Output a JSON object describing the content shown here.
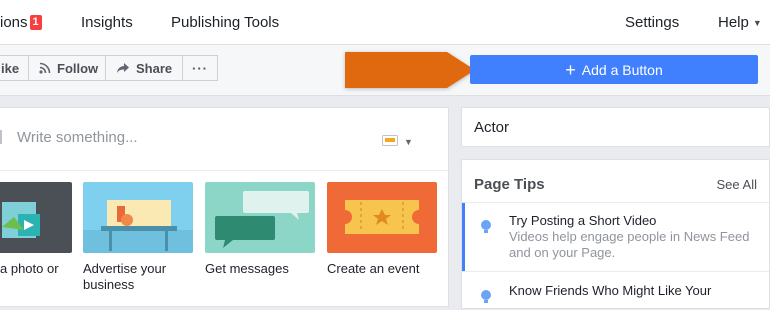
{
  "topnav": {
    "notifications_label": "ions",
    "notifications_count": "1",
    "insights": "Insights",
    "publishing_tools": "Publishing Tools",
    "settings": "Settings",
    "help": "Help"
  },
  "actions": {
    "like": "ike",
    "follow": "Follow",
    "share": "Share",
    "more": "···",
    "add_button": "Add a Button"
  },
  "composer": {
    "placeholder": "Write something...",
    "tiles": [
      {
        "label": "a photo or"
      },
      {
        "label": "Advertise your business"
      },
      {
        "label": "Get messages"
      },
      {
        "label": "Create an event"
      }
    ]
  },
  "sidebar": {
    "category": "Actor",
    "tips": {
      "title": "Page Tips",
      "see_all": "See All",
      "items": [
        {
          "title": "Try Posting a Short Video",
          "body": "Videos help engage people in News Feed and on your Page."
        },
        {
          "title": "Know Friends Who Might Like Your",
          "body": ""
        }
      ]
    }
  },
  "colors": {
    "primary": "#4080ff",
    "callout": "#e0690f",
    "badge": "#fa3e3e"
  }
}
